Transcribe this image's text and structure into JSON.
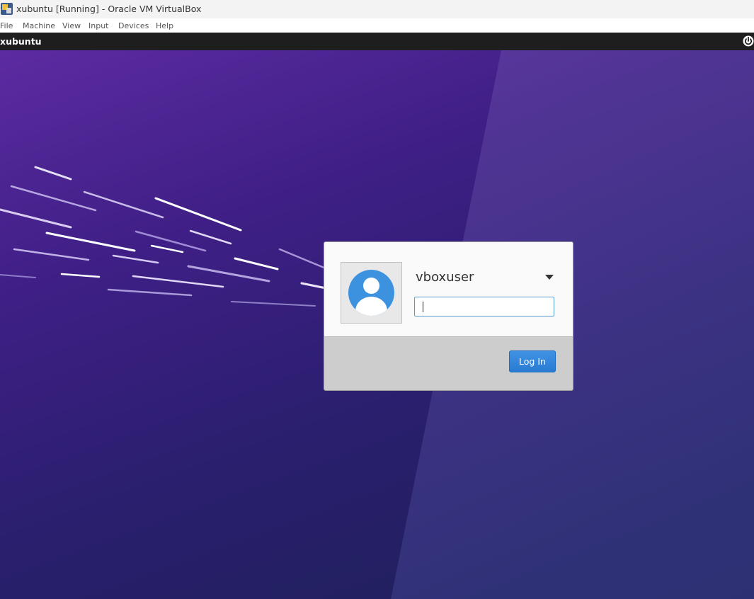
{
  "window": {
    "title": "xubuntu [Running] - Oracle VM VirtualBox",
    "app_icon": "virtualbox-icon"
  },
  "menubar": {
    "items": [
      {
        "label": "File"
      },
      {
        "label": "Machine"
      },
      {
        "label": "View"
      },
      {
        "label": "Input"
      },
      {
        "label": "Devices"
      },
      {
        "label": "Help"
      }
    ]
  },
  "vm_top_bar": {
    "hostname": "xubuntu",
    "power_icon": "power-icon"
  },
  "login": {
    "username": "vboxuser",
    "user_dropdown_icon": "chevron-down-icon",
    "avatar_icon": "user-avatar-icon",
    "password_value": "",
    "login_button": "Log In"
  },
  "colors": {
    "desktop_top": "#5c2ba1",
    "desktop_bottom": "#1d2058",
    "accent_button": "#2a7bd3"
  }
}
